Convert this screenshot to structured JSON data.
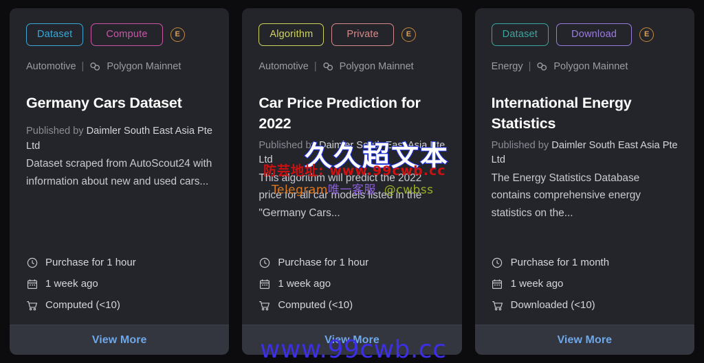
{
  "page": {
    "background": "#0c0c0e",
    "card_background": "#24252b",
    "footer_background": "#33353f",
    "link_color": "#6ea8e8"
  },
  "cards": [
    {
      "type_badge": {
        "label": "Dataset",
        "color": "#3aa8d8"
      },
      "access_badge": {
        "label": "Compute",
        "color": "#cc55a8"
      },
      "chain_badge": {
        "label": "E",
        "color": "#d9a05b",
        "name": "ethereum-badge"
      },
      "category": "Automotive",
      "separator": "|",
      "network": "Polygon Mainnet",
      "title": "Germany Cars Dataset",
      "published_label": "Published by",
      "publisher": "Daimler South East Asia Pte Ltd",
      "description": "Dataset scraped from AutoScout24 with information about new and used cars...",
      "meta": [
        {
          "icon": "clock-icon",
          "text": "Purchase for 1 hour"
        },
        {
          "icon": "calendar-icon",
          "text": "1 week ago"
        },
        {
          "icon": "cart-icon",
          "text": "Computed (<10)"
        }
      ],
      "footer_label": "View More"
    },
    {
      "type_badge": {
        "label": "Algorithm",
        "color": "#cfd45e"
      },
      "access_badge": {
        "label": "Private",
        "color": "#d88a8a"
      },
      "chain_badge": {
        "label": "E",
        "color": "#d9a05b",
        "name": "ethereum-badge"
      },
      "category": "Automotive",
      "separator": "|",
      "network": "Polygon Mainnet",
      "title": "Car Price Prediction for 2022",
      "published_label": "Published by",
      "publisher": "Daimler South East Asia Pte Ltd",
      "description": "This algorithm will predict the 2022 price for all car models listed in the \"Germany Cars...",
      "meta": [
        {
          "icon": "clock-icon",
          "text": "Purchase for 1 hour"
        },
        {
          "icon": "calendar-icon",
          "text": "1 week ago"
        },
        {
          "icon": "cart-icon",
          "text": "Computed (<10)"
        }
      ],
      "footer_label": "View More"
    },
    {
      "type_badge": {
        "label": "Dataset",
        "color": "#3aa8a0"
      },
      "access_badge": {
        "label": "Download",
        "color": "#9b7de0"
      },
      "chain_badge": {
        "label": "E",
        "color": "#d9a05b",
        "name": "ethereum-badge"
      },
      "category": "Energy",
      "separator": "|",
      "network": "Polygon Mainnet",
      "title": "International Energy Statistics",
      "published_label": "Published by",
      "publisher": "Daimler South East Asia Pte Ltd",
      "description": "The Energy Statistics Database contains comprehensive energy statistics on the...",
      "meta": [
        {
          "icon": "clock-icon",
          "text": "Purchase for 1 month"
        },
        {
          "icon": "calendar-icon",
          "text": "1 week ago"
        },
        {
          "icon": "cart-icon",
          "text": "Downloaded (<10)"
        }
      ],
      "footer_label": "View More"
    }
  ],
  "watermarks": {
    "chinese_title": "久久超文本",
    "red_line": "防芸地址: www.99cwb.cc",
    "telegram_label": "Telegram",
    "telegram_cn": "唯一客服",
    "telegram_handle": "@cwbss",
    "bottom_url": "www.99cwb.cc"
  }
}
